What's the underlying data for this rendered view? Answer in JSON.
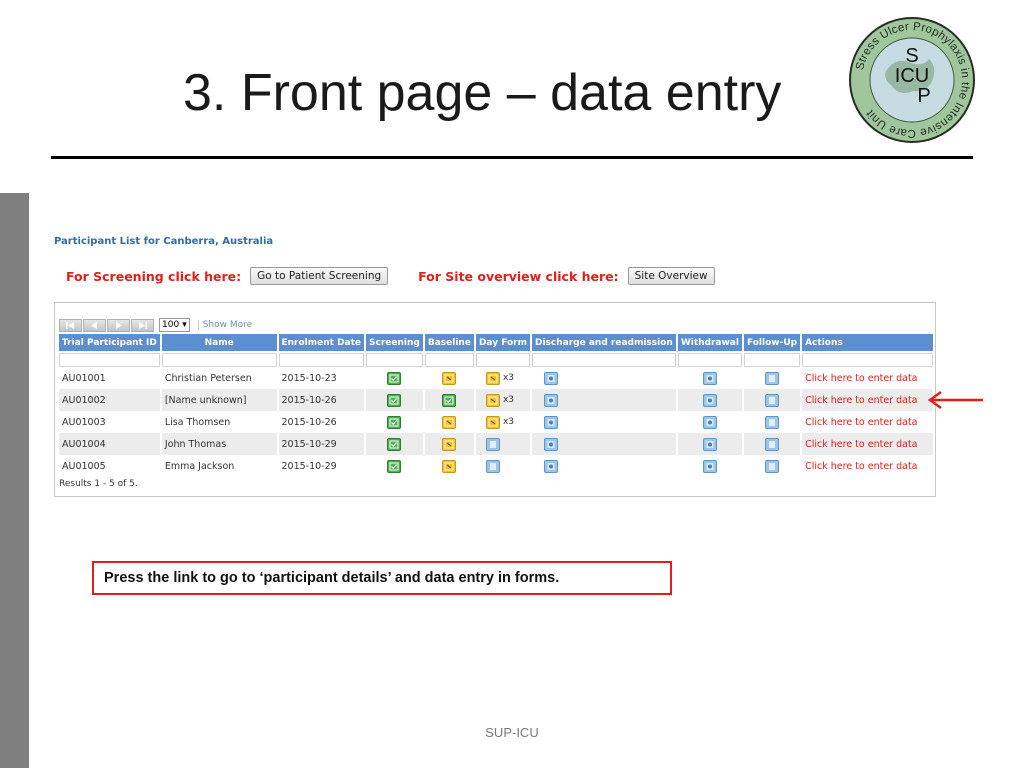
{
  "slide": {
    "title": "3. Front page – data entry",
    "footer": "SUP-ICU",
    "callout": "Press the link to go to ‘participant details’ and data entry  in forms."
  },
  "logo": {
    "ring_text": "Stress Ulcer Prophylaxis in the Intensive Care Unit",
    "letters": [
      "S",
      "ICU",
      "P"
    ]
  },
  "app": {
    "list_title": "Participant List for Canberra, Australia",
    "screening_label": "For Screening click here:",
    "screening_button": "Go to Patient Screening",
    "site_label": "For Site overview click here:",
    "site_button": "Site Overview",
    "page_size": "100",
    "show_more": "Show More",
    "results": "Results 1 - 5 of 5."
  },
  "table": {
    "columns": [
      "Trial Participant ID",
      "Name",
      "Enrolment Date",
      "Screening",
      "Baseline",
      "Day Form",
      "Discharge and readmission",
      "Withdrawal",
      "Follow-Up",
      "Actions"
    ],
    "rows": [
      {
        "id": "AU01001",
        "name": "Christian Petersen",
        "date": "2015-10-23",
        "screening": "complete-icon",
        "baseline": "edit-icon",
        "dayform": "edit-icon",
        "dayform_count": "x3",
        "discharge": "form-icon",
        "withdrawal": "form-icon",
        "followup": "blank-form-icon",
        "action": "Click here to enter data"
      },
      {
        "id": "AU01002",
        "name": "[Name unknown]",
        "date": "2015-10-26",
        "screening": "complete-icon",
        "baseline": "complete-icon",
        "dayform": "edit-icon",
        "dayform_count": "x3",
        "discharge": "form-icon",
        "withdrawal": "form-icon",
        "followup": "blank-form-icon",
        "action": "Click here to enter data"
      },
      {
        "id": "AU01003",
        "name": "Lisa Thomsen",
        "date": "2015-10-26",
        "screening": "complete-icon",
        "baseline": "edit-icon",
        "dayform": "edit-icon",
        "dayform_count": "x3",
        "discharge": "form-icon",
        "withdrawal": "form-icon",
        "followup": "blank-form-icon",
        "action": "Click here to enter data"
      },
      {
        "id": "AU01004",
        "name": "John Thomas",
        "date": "2015-10-29",
        "screening": "complete-icon",
        "baseline": "edit-icon",
        "dayform": "blank-form-icon",
        "dayform_count": "",
        "discharge": "form-icon",
        "withdrawal": "form-icon",
        "followup": "blank-form-icon",
        "action": "Click here to enter data"
      },
      {
        "id": "AU01005",
        "name": "Emma Jackson",
        "date": "2015-10-29",
        "screening": "complete-icon",
        "baseline": "edit-icon",
        "dayform": "blank-form-icon",
        "dayform_count": "",
        "discharge": "form-icon",
        "withdrawal": "form-icon",
        "followup": "blank-form-icon",
        "action": "Click here to enter data"
      }
    ]
  },
  "colors": {
    "header_blue": "#5b8fd0",
    "link_red": "#e0201a",
    "status_green": "#4caf50",
    "status_yellow": "#f2c330",
    "status_blue": "#9cc5e8"
  }
}
